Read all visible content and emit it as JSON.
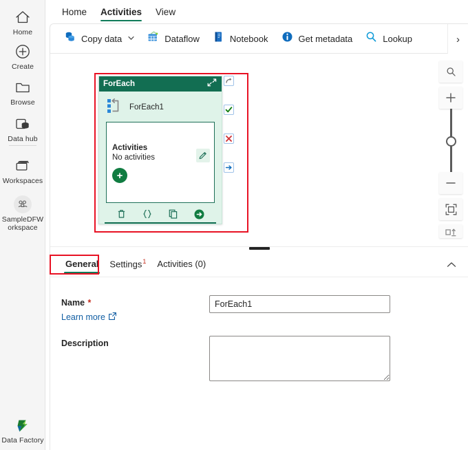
{
  "rail": {
    "items": [
      {
        "label": "Home",
        "icon": "home-icon"
      },
      {
        "label": "Create",
        "icon": "plus-circle-icon"
      },
      {
        "label": "Browse",
        "icon": "folder-icon"
      },
      {
        "label": "Data hub",
        "icon": "data-hub-icon"
      },
      {
        "label": "Workspaces",
        "icon": "workspaces-icon"
      },
      {
        "label": "SampleDFWorkspace",
        "icon": "workspace-people-icon"
      }
    ],
    "workspace_line1": "SampleDFW",
    "workspace_line2": "orkspace",
    "product": {
      "label": "Data Factory",
      "icon": "data-factory-logo"
    }
  },
  "tabstrip": {
    "tabs": [
      {
        "label": "Home",
        "active": false
      },
      {
        "label": "Activities",
        "active": true
      },
      {
        "label": "View",
        "active": false
      }
    ]
  },
  "ribbon": {
    "items": [
      {
        "label": "Copy data",
        "icon": "copy-data-icon",
        "has_caret": true
      },
      {
        "label": "Dataflow",
        "icon": "dataflow-icon",
        "has_caret": false
      },
      {
        "label": "Notebook",
        "icon": "notebook-icon",
        "has_caret": false
      },
      {
        "label": "Get metadata",
        "icon": "info-icon",
        "has_caret": false
      },
      {
        "label": "Lookup",
        "icon": "magnifier-icon",
        "has_caret": false
      }
    ],
    "overflow_label": "›",
    "caret_glyph": "∨"
  },
  "canvas": {
    "node": {
      "header_title": "ForEach",
      "header_action_icon": "expand-collapse-arrows-icon",
      "activity_name": "ForEach1",
      "activity_icon": "foreach-loop-icon",
      "inner": {
        "title": "Activities",
        "subtitle": "No activities",
        "edit_icon": "pencil-icon",
        "add_label": "+",
        "add_icon": "add-activity-icon"
      },
      "footer_icons": [
        {
          "name": "delete-icon"
        },
        {
          "name": "code-braces-icon"
        },
        {
          "name": "copy-icon"
        },
        {
          "name": "run-arrow-icon"
        }
      ],
      "handles": [
        {
          "name": "on-skip-handle",
          "glyph": "⤴",
          "color": "#767676"
        },
        {
          "name": "on-success-handle",
          "glyph": "✔",
          "color": "#107c10"
        },
        {
          "name": "on-failure-handle",
          "glyph": "✖",
          "color": "#d13438"
        },
        {
          "name": "on-completion-handle",
          "glyph": "→",
          "color": "#0f6cbd"
        }
      ]
    },
    "zoom_controls": [
      {
        "name": "zoom-search-icon"
      },
      {
        "name": "zoom-in-icon",
        "glyph": "+"
      },
      {
        "name": "zoom-slider"
      },
      {
        "name": "zoom-out-icon",
        "glyph": "–"
      },
      {
        "name": "fit-to-screen-icon"
      },
      {
        "name": "auto-align-icon"
      }
    ]
  },
  "detail": {
    "tabs": [
      {
        "label": "General",
        "active": true,
        "badge": ""
      },
      {
        "label": "Settings",
        "active": false,
        "badge": "1"
      },
      {
        "label": "Activities (0)",
        "active": false,
        "badge": ""
      }
    ],
    "collapse_icon": "chevron-up-icon",
    "form": {
      "name_label": "Name",
      "name_required": "*",
      "learn_more": "Learn more",
      "learn_more_icon": "external-link-icon",
      "name_value": "ForEach1",
      "name_placeholder": "",
      "description_label": "Description",
      "description_value": "",
      "description_placeholder": ""
    }
  },
  "colors": {
    "accent_teal": "#107c5a",
    "node_header": "#126e52",
    "node_body": "#dff3e9",
    "annotation_red": "#e81123",
    "link_blue": "#115ea3",
    "success_green": "#107c10",
    "error_red": "#d13438"
  }
}
